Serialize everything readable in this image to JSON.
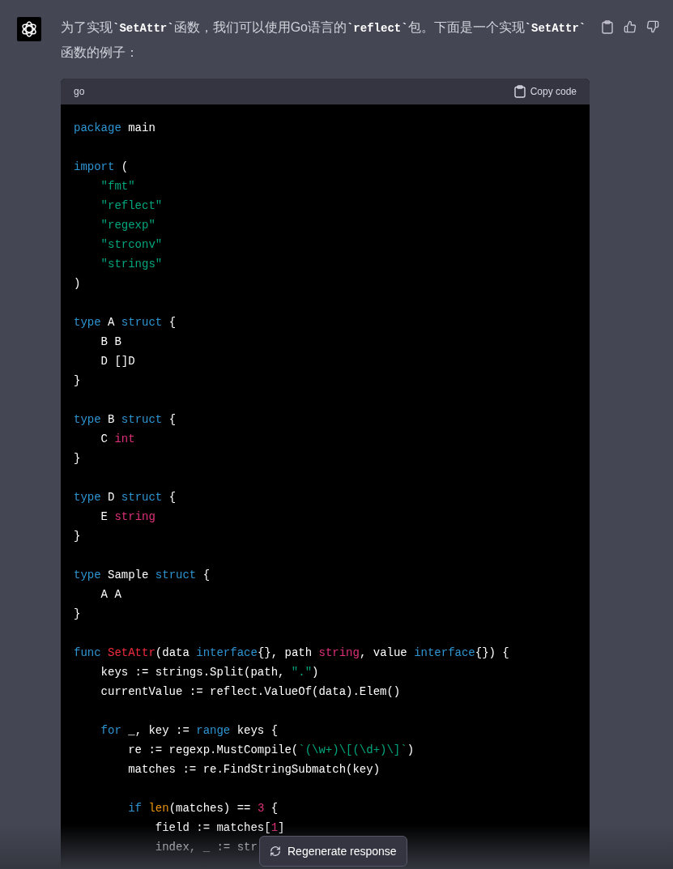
{
  "message": {
    "text": "为了实现**`SetAttr`**函数，我们可以使用Go语言的**`reflect`**包。下面是一个实现**`SetAttr`**函数的例子："
  },
  "code_block": {
    "language": "go",
    "copy_label": "Copy code",
    "lines": [
      {
        "kind": "code",
        "tokens": [
          {
            "text": "package",
            "kind": "keyword"
          },
          {
            "text": " main",
            "kind": "plain"
          }
        ]
      },
      {
        "kind": "blank"
      },
      {
        "kind": "code",
        "tokens": [
          {
            "text": "import",
            "kind": "keyword"
          },
          {
            "text": " (",
            "kind": "plain"
          }
        ]
      },
      {
        "kind": "code",
        "tokens": [
          {
            "text": "    \"fmt\"",
            "kind": "string"
          }
        ]
      },
      {
        "kind": "code",
        "tokens": [
          {
            "text": "    \"reflect\"",
            "kind": "string"
          }
        ]
      },
      {
        "kind": "code",
        "tokens": [
          {
            "text": "    \"regexp\"",
            "kind": "string"
          }
        ]
      },
      {
        "kind": "code",
        "tokens": [
          {
            "text": "    \"strconv\"",
            "kind": "string"
          }
        ]
      },
      {
        "kind": "code",
        "tokens": [
          {
            "text": "    \"strings\"",
            "kind": "string"
          }
        ]
      },
      {
        "kind": "code",
        "tokens": [
          {
            "text": ")",
            "kind": "plain"
          }
        ]
      },
      {
        "kind": "blank"
      },
      {
        "kind": "code",
        "tokens": [
          {
            "text": "type",
            "kind": "keyword"
          },
          {
            "text": " A ",
            "kind": "plain"
          },
          {
            "text": "struct",
            "kind": "keyword"
          },
          {
            "text": " {",
            "kind": "plain"
          }
        ]
      },
      {
        "kind": "code",
        "tokens": [
          {
            "text": "    B B",
            "kind": "plain"
          }
        ]
      },
      {
        "kind": "code",
        "tokens": [
          {
            "text": "    D []D",
            "kind": "plain"
          }
        ]
      },
      {
        "kind": "code",
        "tokens": [
          {
            "text": "}",
            "kind": "plain"
          }
        ]
      },
      {
        "kind": "blank"
      },
      {
        "kind": "code",
        "tokens": [
          {
            "text": "type",
            "kind": "keyword"
          },
          {
            "text": " B ",
            "kind": "plain"
          },
          {
            "text": "struct",
            "kind": "keyword"
          },
          {
            "text": " {",
            "kind": "plain"
          }
        ]
      },
      {
        "kind": "code",
        "tokens": [
          {
            "text": "    C ",
            "kind": "plain"
          },
          {
            "text": "int",
            "kind": "type"
          }
        ]
      },
      {
        "kind": "code",
        "tokens": [
          {
            "text": "}",
            "kind": "plain"
          }
        ]
      },
      {
        "kind": "blank"
      },
      {
        "kind": "code",
        "tokens": [
          {
            "text": "type",
            "kind": "keyword"
          },
          {
            "text": " D ",
            "kind": "plain"
          },
          {
            "text": "struct",
            "kind": "keyword"
          },
          {
            "text": " {",
            "kind": "plain"
          }
        ]
      },
      {
        "kind": "code",
        "tokens": [
          {
            "text": "    E ",
            "kind": "plain"
          },
          {
            "text": "string",
            "kind": "type"
          }
        ]
      },
      {
        "kind": "code",
        "tokens": [
          {
            "text": "}",
            "kind": "plain"
          }
        ]
      },
      {
        "kind": "blank"
      },
      {
        "kind": "code",
        "tokens": [
          {
            "text": "type",
            "kind": "keyword"
          },
          {
            "text": " Sample ",
            "kind": "plain"
          },
          {
            "text": "struct",
            "kind": "keyword"
          },
          {
            "text": " {",
            "kind": "plain"
          }
        ]
      },
      {
        "kind": "code",
        "tokens": [
          {
            "text": "    A A",
            "kind": "plain"
          }
        ]
      },
      {
        "kind": "code",
        "tokens": [
          {
            "text": "}",
            "kind": "plain"
          }
        ]
      },
      {
        "kind": "blank"
      },
      {
        "kind": "code",
        "tokens": [
          {
            "text": "func",
            "kind": "keyword"
          },
          {
            "text": " SetAttr",
            "kind": "function"
          },
          {
            "text": "(data ",
            "kind": "plain"
          },
          {
            "text": "interface",
            "kind": "keyword"
          },
          {
            "text": "{}, path ",
            "kind": "plain"
          },
          {
            "text": "string",
            "kind": "type"
          },
          {
            "text": ", value ",
            "kind": "plain"
          },
          {
            "text": "interface",
            "kind": "keyword"
          },
          {
            "text": "{}) {",
            "kind": "plain"
          }
        ]
      },
      {
        "kind": "code",
        "tokens": [
          {
            "text": "    keys := strings.Split(path, ",
            "kind": "plain"
          },
          {
            "text": "\".\"",
            "kind": "string"
          },
          {
            "text": ")",
            "kind": "plain"
          }
        ]
      },
      {
        "kind": "code",
        "tokens": [
          {
            "text": "    currentValue := reflect.ValueOf(data).Elem()",
            "kind": "plain"
          }
        ]
      },
      {
        "kind": "blank"
      },
      {
        "kind": "code",
        "tokens": [
          {
            "text": "    for",
            "kind": "keyword"
          },
          {
            "text": " _, key := ",
            "kind": "plain"
          },
          {
            "text": "range",
            "kind": "keyword"
          },
          {
            "text": " keys {",
            "kind": "plain"
          }
        ]
      },
      {
        "kind": "code",
        "tokens": [
          {
            "text": "        re := regexp.MustCompile(",
            "kind": "plain"
          },
          {
            "text": "`(\\w+)\\[(\\d+)\\]`",
            "kind": "string"
          },
          {
            "text": ")",
            "kind": "plain"
          }
        ]
      },
      {
        "kind": "code",
        "tokens": [
          {
            "text": "        matches := re.FindStringSubmatch(key)",
            "kind": "plain"
          }
        ]
      },
      {
        "kind": "blank"
      },
      {
        "kind": "code",
        "tokens": [
          {
            "text": "        if",
            "kind": "keyword"
          },
          {
            "text": " len",
            "kind": "builtin"
          },
          {
            "text": "(matches) == ",
            "kind": "plain"
          },
          {
            "text": "3",
            "kind": "number"
          },
          {
            "text": " {",
            "kind": "plain"
          }
        ]
      },
      {
        "kind": "code",
        "tokens": [
          {
            "text": "            field := matches[",
            "kind": "plain"
          },
          {
            "text": "1",
            "kind": "number"
          },
          {
            "text": "]",
            "kind": "plain"
          }
        ]
      },
      {
        "kind": "code",
        "tokens": [
          {
            "text": "            index, _ := str",
            "kind": "plain"
          }
        ]
      }
    ]
  },
  "regenerate_button": {
    "label": "Regenerate response"
  }
}
